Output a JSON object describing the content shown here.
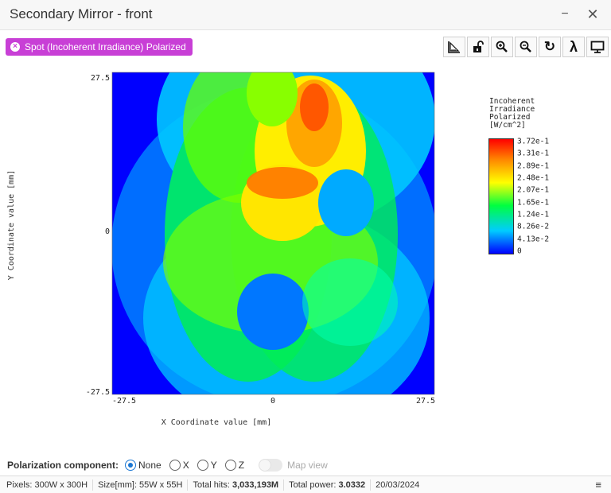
{
  "window": {
    "title": "Secondary Mirror - front",
    "minimize": "−",
    "close": "✕"
  },
  "analysis_chip": {
    "label": "Spot (Incoherent Irradiance) Polarized",
    "icon": "close-circle-icon"
  },
  "toolbar": {
    "tools": [
      {
        "name": "ruler-tool",
        "icon": "ruler-icon"
      },
      {
        "name": "lock-tool",
        "icon": "unlock-icon"
      },
      {
        "name": "zoom-in-tool",
        "icon": "zoom-in-icon"
      },
      {
        "name": "zoom-out-tool",
        "icon": "zoom-out-icon"
      },
      {
        "name": "refresh-tool",
        "icon": "refresh-icon",
        "glyph": "↻"
      },
      {
        "name": "wavelength-tool",
        "icon": "lambda-icon",
        "glyph": "λ"
      },
      {
        "name": "display-tool",
        "icon": "monitor-icon"
      }
    ]
  },
  "chart_data": {
    "type": "heatmap",
    "xlabel": "X Coordinate value [mm]",
    "ylabel": "Y Coordinate value [mm]",
    "xlim": [
      -27.5,
      27.5
    ],
    "ylim": [
      -27.5,
      27.5
    ],
    "x_ticks": [
      "-27.5",
      "0",
      "27.5"
    ],
    "y_ticks": [
      "27.5",
      "0",
      "-27.5"
    ],
    "colorscale": [
      "#0000ff",
      "#00ccff",
      "#00ff40",
      "#ffff00",
      "#ff8800",
      "#ff0000"
    ],
    "legend": {
      "title_lines": [
        "Incoherent",
        "Irradiance",
        "Polarized",
        "[W/cm^2]"
      ],
      "labels": [
        "3.72e-1",
        "3.31e-1",
        "2.89e-1",
        "2.48e-1",
        "2.07e-1",
        "1.65e-1",
        "1.24e-1",
        "8.26e-2",
        "4.13e-2",
        "0"
      ]
    }
  },
  "polarization": {
    "label": "Polarization component:",
    "options": [
      "None",
      "X",
      "Y",
      "Z"
    ],
    "selected": "None",
    "map_view_label": "Map view",
    "map_view_enabled": false
  },
  "statusbar": {
    "pixels": "Pixels: 300W x 300H",
    "size": "Size[mm]: 55W x 55H",
    "hits_prefix": "Total hits: ",
    "hits_value": "3,033,193M",
    "power_prefix": "Total power: ",
    "power_value": "3.0332",
    "date": "20/03/2024",
    "menu_icon": "hamburger-menu-icon"
  }
}
